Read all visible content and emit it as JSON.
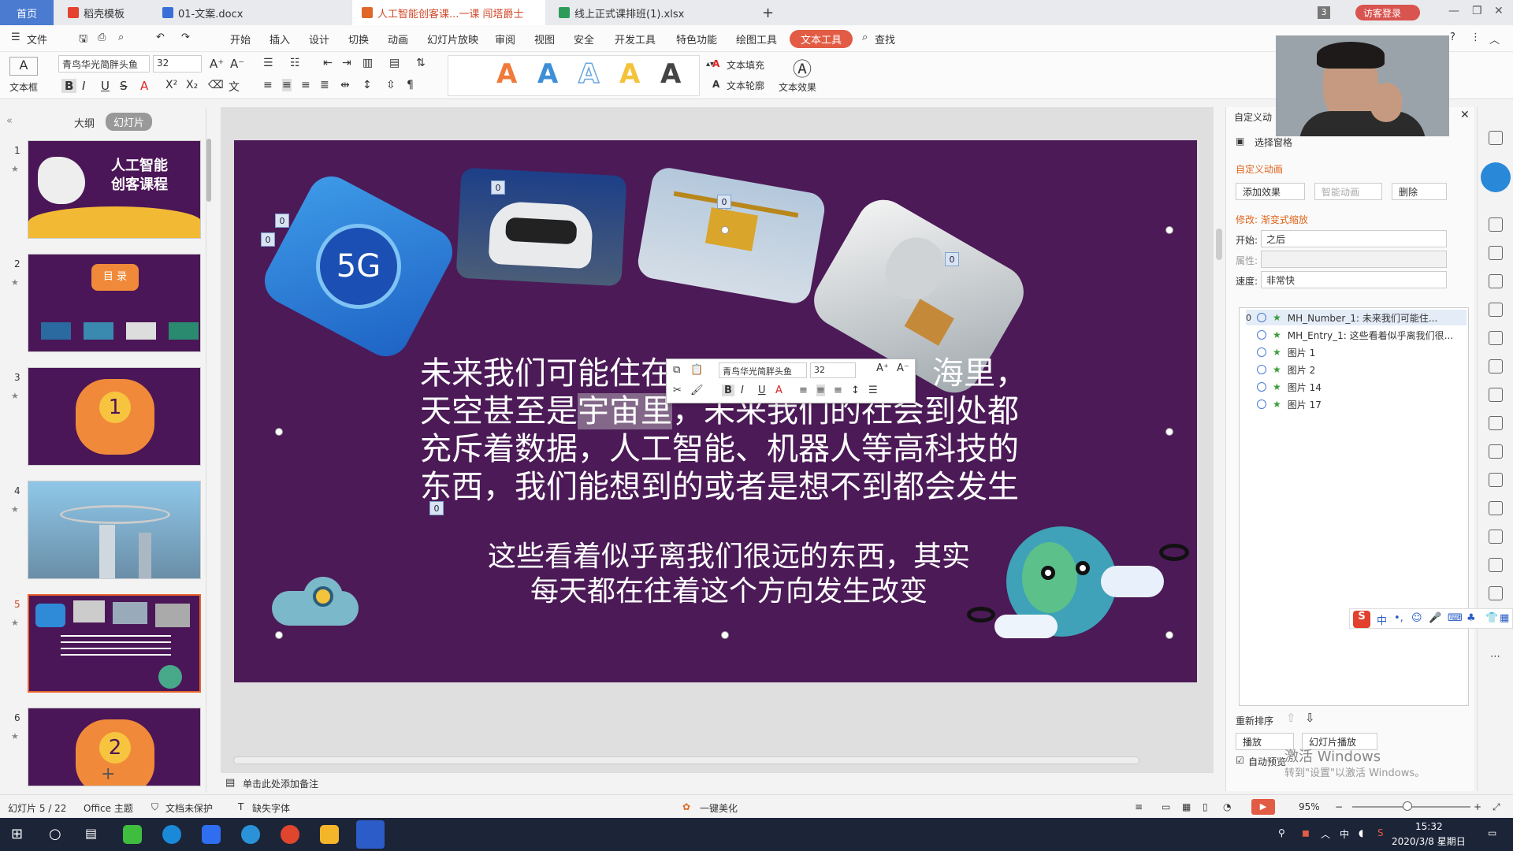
{
  "tabs": {
    "home": "首页",
    "t1": "稻壳模板",
    "t2": "01-文案.docx",
    "t3": "人工智能创客课...一课 闯塔爵士",
    "t4": "线上正式课排班(1).xlsx",
    "t5": "+",
    "badge": "3",
    "login": "访客登录"
  },
  "menu": {
    "file": "文件",
    "items": [
      "开始",
      "插入",
      "设计",
      "切换",
      "动画",
      "幻灯片放映",
      "审阅",
      "视图",
      "安全",
      "开发工具",
      "特色功能",
      "绘图工具"
    ],
    "text_tool": "文本工具",
    "search": "查找"
  },
  "ribbon": {
    "textbox": "文本框",
    "font": "青鸟华光简胖头鱼",
    "size": "32",
    "fill": "文本填充",
    "outline": "文本轮廓",
    "effect": "文本效果",
    "styles": [
      "A",
      "A",
      "A",
      "A",
      "A"
    ],
    "style_colors": [
      "#f07a3a",
      "#3d8fd8",
      "#aad2f0",
      "#f3c33c",
      "#444444"
    ]
  },
  "left": {
    "outline_tab": "大纲",
    "slides_tab": "幻灯片",
    "slide_nums": [
      "1",
      "2",
      "3",
      "4",
      "5",
      "6"
    ],
    "thumb1_title": "人工智能\n创客课程",
    "thumb2_title": "目 录",
    "thumb3_num": "1",
    "thumb6_num": "2",
    "add": "+"
  },
  "slide": {
    "main_text": "未来我们可能住在 海里，天空甚至是宇宙里，未来我们的社会到处都充斥着数据，人工智能、机器人等高科技的东西，我们能想到的或者是想不到都会发生",
    "main_line1a": "未来我们可能住在",
    "main_line1b": "海里，",
    "main_line2a": "天空甚至是",
    "main_line2b": "宇宙里",
    "main_line2c": "，未来我们的社会到处都",
    "main_line3": "充斥着数据，人工智能、机器人等高科技的",
    "main_line4": "东西，我们能想到的或者是想不到都会发生",
    "sub_line1": "这些看着似乎离我们很远的东西，其实",
    "sub_line2": "每天都在往着这个方向发生改变",
    "tag": "0",
    "icon_5g": "5G"
  },
  "minitool": {
    "font": "青鸟华光简胖头鱼",
    "size": "32"
  },
  "right": {
    "title": "自定义动",
    "select_pane": "选择窗格",
    "custom_anim": "自定义动画",
    "add_effect": "添加效果",
    "smart_anim": "智能动画",
    "delete": "删除",
    "modify": "修改: 渐变式缩放",
    "start_label": "开始:",
    "start_value": "之后",
    "prop_label": "属性:",
    "speed_label": "速度:",
    "speed_value": "非常快",
    "anim_items": [
      {
        "idx": "0",
        "label": "MH_Number_1: 未来我们可能住..."
      },
      {
        "idx": "",
        "label": "MH_Entry_1: 这些看着似乎离我们很..."
      },
      {
        "idx": "",
        "label": "图片 1"
      },
      {
        "idx": "",
        "label": "图片 2"
      },
      {
        "idx": "",
        "label": "图片 14"
      },
      {
        "idx": "",
        "label": "图片 17"
      }
    ],
    "reorder": "重新排序",
    "play": "播放",
    "slideshow": "幻灯片播放",
    "autopreview": "自动预览"
  },
  "notes": "单击此处添加备注",
  "status": {
    "slide_count": "幻灯片 5 / 22",
    "theme": "Office 主题",
    "doc_protect": "文档未保护",
    "missing_font": "缺失字体",
    "beautify": "一键美化",
    "zoom": "95%"
  },
  "activate": {
    "line1": "激活 Windows",
    "line2": "转到\"设置\"以激活 Windows。"
  },
  "taskbar": {
    "time": "15:32",
    "date": "2020/3/8 星期日",
    "ime": "中"
  }
}
